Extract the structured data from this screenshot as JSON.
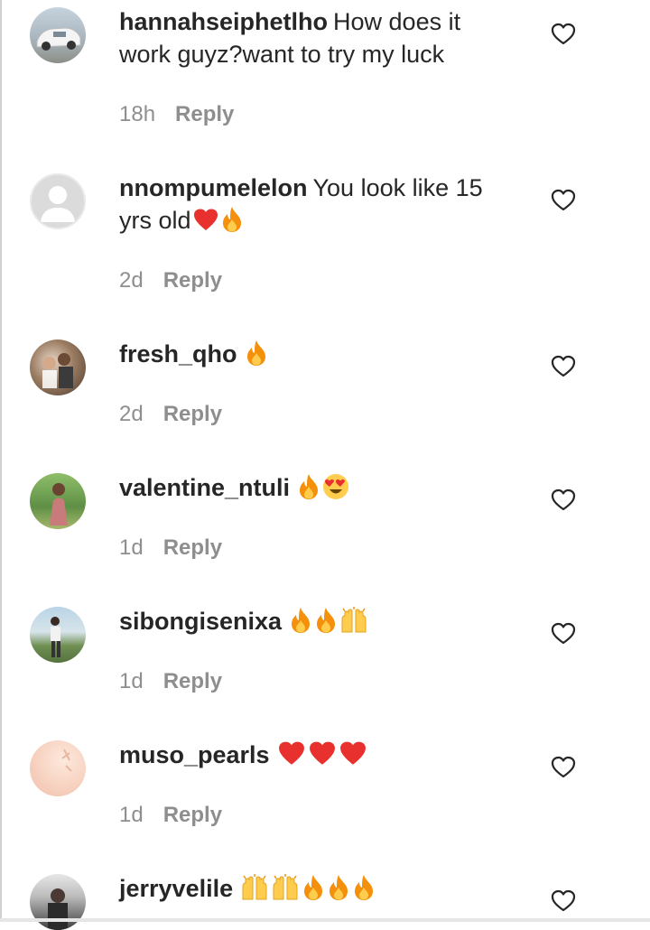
{
  "comments": [
    {
      "username": "hannahseiphetlho",
      "text": "How does it work guyz?want to try my luck",
      "emojis": [],
      "time": "18h",
      "reply": "Reply",
      "avatar": "car-photo"
    },
    {
      "username": "nnompumelelon",
      "text": "You look like 15 yrs old",
      "emojis": [
        "heart",
        "fire"
      ],
      "time": "2d",
      "reply": "Reply",
      "avatar": "default-profile"
    },
    {
      "username": "fresh_qho",
      "text": "",
      "emojis": [
        "fire"
      ],
      "time": "2d",
      "reply": "Reply",
      "avatar": "group-photo"
    },
    {
      "username": "valentine_ntuli",
      "text": "",
      "emojis": [
        "fire",
        "heart-eyes"
      ],
      "time": "1d",
      "reply": "Reply",
      "avatar": "person-photo"
    },
    {
      "username": "sibongisenixa",
      "text": "",
      "emojis": [
        "fire",
        "fire",
        "raised-hands"
      ],
      "time": "1d",
      "reply": "Reply",
      "avatar": "outdoor-photo"
    },
    {
      "username": "muso_pearls",
      "text": "",
      "emojis": [
        "heart",
        "heart",
        "heart"
      ],
      "time": "1d",
      "reply": "Reply",
      "avatar": "peach-photo"
    },
    {
      "username": "jerryvelile",
      "text": "",
      "emojis": [
        "raised-hands",
        "raised-hands",
        "fire",
        "fire",
        "fire"
      ],
      "time": "",
      "reply": "",
      "avatar": "dark-photo"
    }
  ],
  "icons": {
    "like": "heart-outline-icon"
  },
  "colors": {
    "text": "#262626",
    "meta": "#8e8e8e",
    "heart": "#e8302e",
    "fire": "#f4900c",
    "face": "#ffcc4d"
  }
}
